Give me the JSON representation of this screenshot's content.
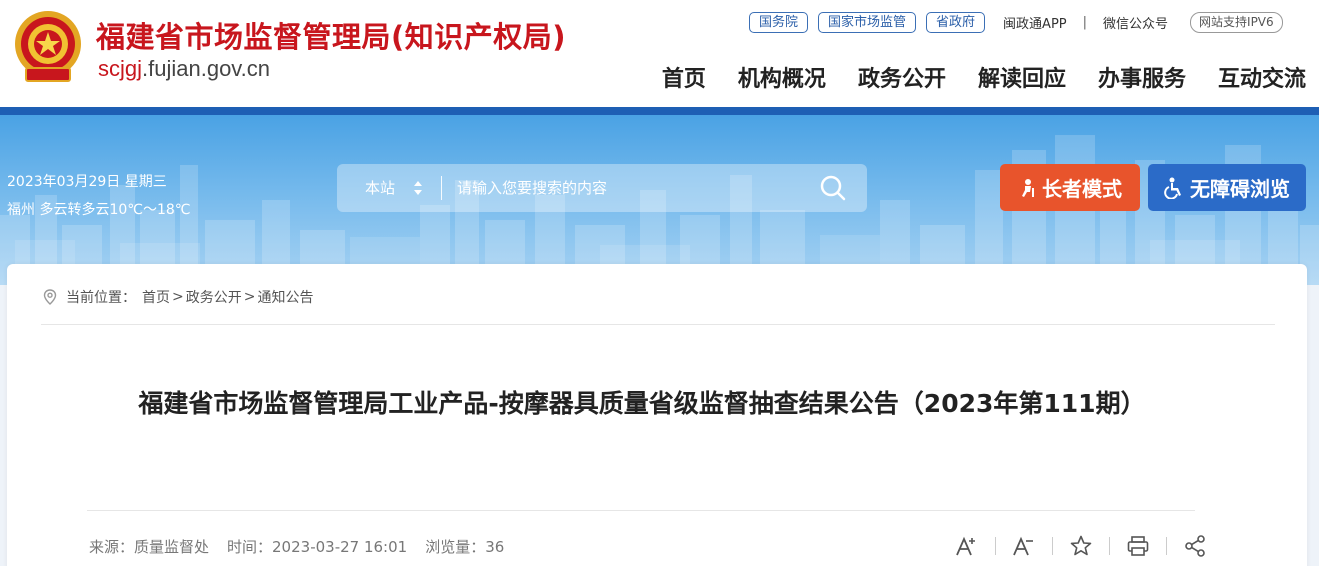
{
  "header": {
    "site_title": "福建省市场监督管理局(知识产权局)",
    "domain_highlight": "scjgj",
    "domain_rest": ".fujian.gov.cn",
    "top_links": {
      "pill_1": "国务院",
      "pill_2": "国家市场监管",
      "pill_3": "省政府",
      "app": "闽政通APP",
      "separator": "|",
      "wechat": "微信公众号",
      "ipv6": "网站支持IPV6"
    },
    "nav": [
      "首页",
      "机构概况",
      "政务公开",
      "解读回应",
      "办事服务",
      "互动交流"
    ]
  },
  "banner": {
    "date": "2023年03月29日 星期三",
    "weather": "福州 多云转多云10℃～18℃",
    "search": {
      "scope": "本站",
      "placeholder": "请输入您要搜索的内容"
    },
    "elder_mode_label": "长者模式",
    "accessibility_label": "无障碍浏览"
  },
  "breadcrumb": {
    "prefix": "当前位置：",
    "items": [
      "首页",
      "政务公开",
      "通知公告"
    ],
    "separator": ">"
  },
  "article": {
    "title": "福建省市场监督管理局工业产品-按摩器具质量省级监督抽查结果公告（2023年第111期）",
    "source": "来源：质量监督处",
    "time": "时间：2023-03-27 16:01",
    "views": "浏览量：36"
  },
  "colors": {
    "brand_red": "#c8161d",
    "gov_blue": "#1e5fb4",
    "elder_orange": "#e8542c",
    "access_blue": "#2b6bc8"
  }
}
